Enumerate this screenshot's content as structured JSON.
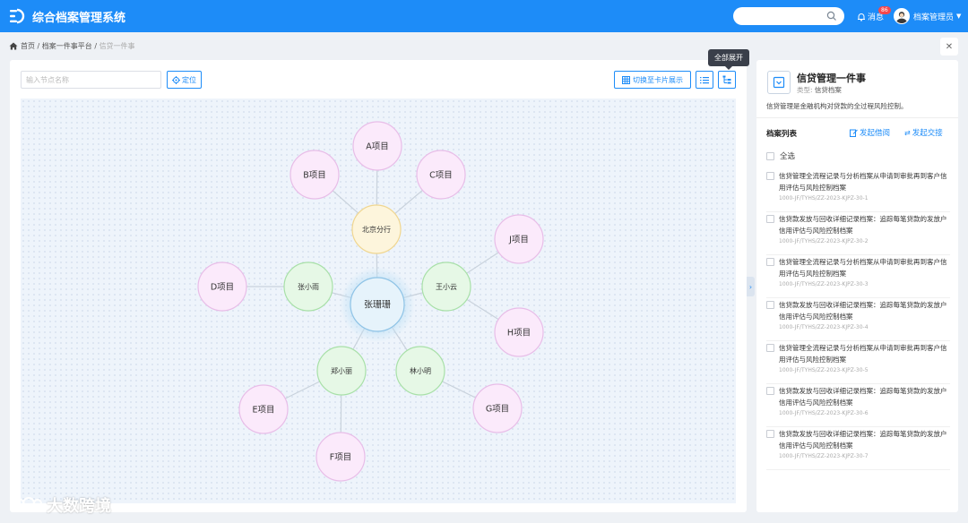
{
  "app": {
    "title": "综合档案管理系统"
  },
  "header": {
    "search_placeholder": "",
    "message_label": "消息",
    "message_count": "86",
    "user_name": "档案管理员"
  },
  "breadcrumb": [
    "首页",
    "档案一件事平台",
    "信贷一件事"
  ],
  "toolbar": {
    "node_input_placeholder": "输入节点名称",
    "locate_label": "定位",
    "card_view_label": "切换至卡片展示",
    "expand_all_tooltip": "全部展开"
  },
  "graph": {
    "nodes": [
      {
        "id": "center",
        "label": "张珊珊",
        "level": 0
      },
      {
        "id": "bj",
        "label": "北京分行",
        "level": 1
      },
      {
        "id": "zxy",
        "label": "张小雨",
        "level": 1
      },
      {
        "id": "wxy",
        "label": "王小云",
        "level": 1
      },
      {
        "id": "zxl",
        "label": "郑小丽",
        "level": 1
      },
      {
        "id": "lxm",
        "label": "林小明",
        "level": 1
      },
      {
        "id": "A",
        "label": "A项目",
        "level": 2
      },
      {
        "id": "B",
        "label": "B项目",
        "level": 2
      },
      {
        "id": "C",
        "label": "C项目",
        "level": 2
      },
      {
        "id": "D",
        "label": "D项目",
        "level": 2
      },
      {
        "id": "J",
        "label": "J项目",
        "level": 2
      },
      {
        "id": "H",
        "label": "H项目",
        "level": 2
      },
      {
        "id": "E",
        "label": "E项目",
        "level": 2
      },
      {
        "id": "F",
        "label": "F项目",
        "level": 2
      },
      {
        "id": "G",
        "label": "G项目",
        "level": 2
      }
    ],
    "edges": [
      [
        "center",
        "bj"
      ],
      [
        "center",
        "zxy"
      ],
      [
        "center",
        "wxy"
      ],
      [
        "center",
        "zxl"
      ],
      [
        "center",
        "lxm"
      ],
      [
        "bj",
        "A"
      ],
      [
        "bj",
        "B"
      ],
      [
        "bj",
        "C"
      ],
      [
        "zxy",
        "D"
      ],
      [
        "wxy",
        "J"
      ],
      [
        "wxy",
        "H"
      ],
      [
        "zxl",
        "E"
      ],
      [
        "zxl",
        "F"
      ],
      [
        "lxm",
        "G"
      ]
    ],
    "colors": {
      "center_fill": "#e6f3fb",
      "center_stroke": "#8ec3e6",
      "branch_fill": "#fdf5dc",
      "branch_stroke": "#f0d690",
      "person_fill": "#e6f8e6",
      "person_stroke": "#a8e0a8",
      "project_fill": "#fbeafb",
      "project_stroke": "#e8bde8",
      "edge": "#c9d2dc"
    }
  },
  "detail": {
    "title": "信贷管理一件事",
    "type_label": "类型:",
    "type_value": "信贷档案",
    "description": "信贷管理是金融机构对贷款的全过程风险控制。",
    "list_title": "档案列表",
    "borrow_label": "发起借阅",
    "transfer_label": "发起交接",
    "select_all_label": "全选",
    "archives": [
      {
        "title": "信贷管理全流程记录与分析档案从申请到审批再到客户信用评估与风险控制档案",
        "code": "1000-JF/TYHS/ZZ-2023-KJPZ-30-1"
      },
      {
        "title": "信贷款发放与回收详细记录档案：追踪每笔贷款的发放户信用评估与风险控制档案",
        "code": "1000-JF/TYHS/ZZ-2023-KJPZ-30-2"
      },
      {
        "title": "信贷管理全流程记录与分析档案从申请到审批再到客户信用评估与风险控制档案",
        "code": "1000-JF/TYHS/ZZ-2023-KJPZ-30-3"
      },
      {
        "title": "信贷款发放与回收详细记录档案：追踪每笔贷款的发放户信用评估与风险控制档案",
        "code": "1000-JF/TYHS/ZZ-2023-KJPZ-30-4"
      },
      {
        "title": "信贷管理全流程记录与分析档案从申请到审批再到客户信用评估与风险控制档案",
        "code": "1000-JF/TYHS/ZZ-2023-KJPZ-30-5"
      },
      {
        "title": "信贷款发放与回收详细记录档案：追踪每笔贷款的发放户信用评估与风险控制档案",
        "code": "1000-JF/TYHS/ZZ-2023-KJPZ-30-6"
      },
      {
        "title": "信贷款发放与回收详细记录档案：追踪每笔贷款的发放户信用评估与风险控制档案",
        "code": "1000-JF/TYHS/ZZ-2023-KJPZ-30-7"
      }
    ]
  },
  "watermark": {
    "text": "大数跨境"
  },
  "theme": {
    "primary": "#1d8cf8",
    "badge": "#f5484d"
  }
}
